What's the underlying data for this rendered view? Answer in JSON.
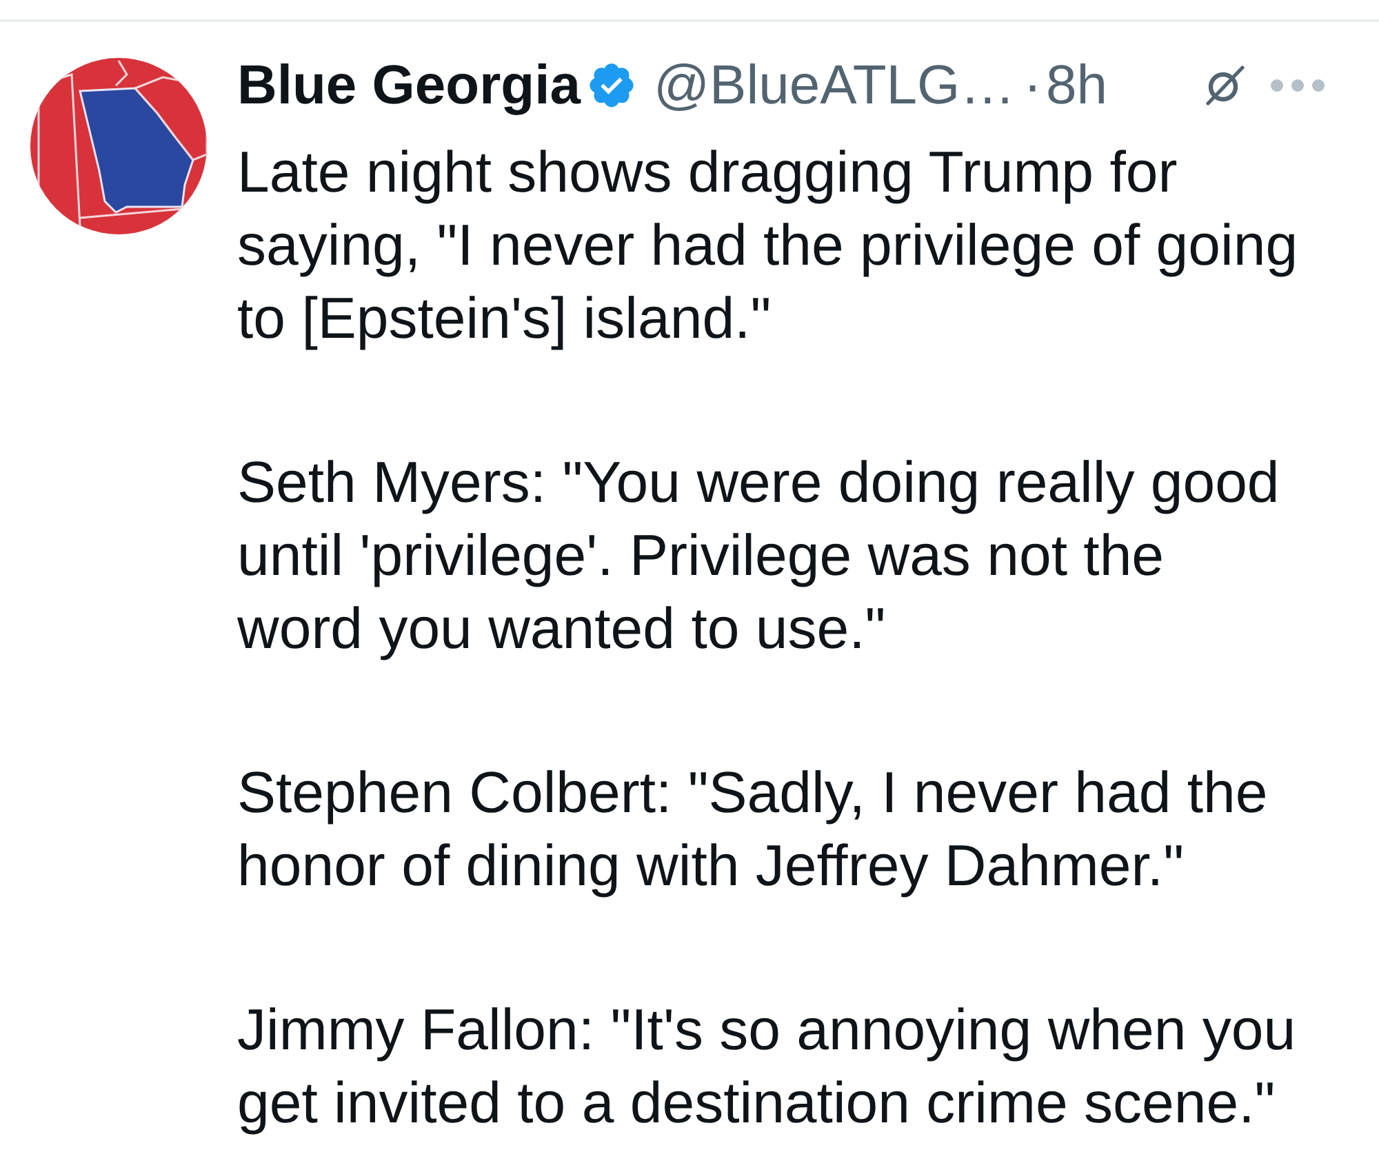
{
  "tweet": {
    "author": {
      "name": "Blue Georgia",
      "verified": true,
      "handle": "@BlueATLG…",
      "separator": "·",
      "time": "8h"
    },
    "paragraphs": [
      "Late night shows dragging Trump for saying, \"I never had the privilege of going to [Epstein's] island.\"",
      "Seth Myers: \"You were doing really good until 'privilege'. Privilege was not the word you wanted to use.\"",
      "Stephen Colbert: \"Sadly, I never had the honor of dining with Jeffrey Dahmer.\"",
      "Jimmy Fallon: \"It's so annoying when you get invited to a destination crime scene.\""
    ]
  }
}
